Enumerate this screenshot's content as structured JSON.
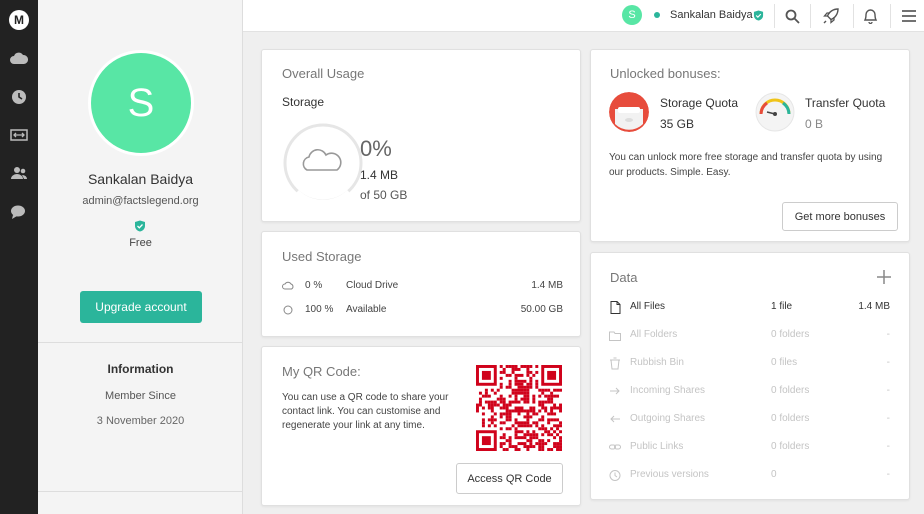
{
  "rail": {
    "logo": "M",
    "icons": [
      "cloud-icon",
      "clock-icon",
      "transfer-icon",
      "contacts-icon",
      "chat-icon"
    ]
  },
  "profile": {
    "avatar_letter": "S",
    "name": "Sankalan Baidya",
    "email": "admin@factslegend.org",
    "plan": "Free",
    "upgrade_label": "Upgrade account",
    "info_heading": "Information",
    "member_since_label": "Member Since",
    "member_since_date": "3 November 2020"
  },
  "topbar": {
    "avatar_letter": "S",
    "user_name": "Sankalan Baidya",
    "status_color": "#2bb59b",
    "icons": [
      "search-icon",
      "rocket-icon",
      "bell-icon",
      "menu-icon"
    ]
  },
  "overall_usage": {
    "title": "Overall Usage",
    "subtitle": "Storage",
    "percent": "0%",
    "used": "1.4 MB",
    "total": "of 50 GB",
    "fill_fraction": 0
  },
  "used_storage": {
    "title": "Used Storage",
    "rows": [
      {
        "icon": "cloud-icon",
        "percent": "0 %",
        "label": "Cloud Drive",
        "value": "1.4 MB"
      },
      {
        "icon": "circle-icon",
        "percent": "100 %",
        "label": "Available",
        "value": "50.00 GB"
      }
    ]
  },
  "qr": {
    "title": "My QR Code:",
    "text": "You can use a QR code to share your contact link. You can customise and regenerate your link at any time.",
    "button": "Access QR Code",
    "color": "#d0021b"
  },
  "bonuses": {
    "title": "Unlocked bonuses:",
    "storage_label": "Storage Quota",
    "storage_value": "35 GB",
    "transfer_label": "Transfer Quota",
    "transfer_value": "0 B",
    "description": "You can unlock more free storage and transfer quota by using our products. Simple. Easy.",
    "button": "Get more bonuses"
  },
  "data": {
    "title": "Data",
    "rows": [
      {
        "icon": "file-icon",
        "label": "All Files",
        "count": "1 file",
        "size": "1.4 MB",
        "active": true
      },
      {
        "icon": "folder-icon",
        "label": "All Folders",
        "count": "0 folders",
        "size": "-",
        "active": false
      },
      {
        "icon": "trash-icon",
        "label": "Rubbish Bin",
        "count": "0 files",
        "size": "-",
        "active": false
      },
      {
        "icon": "incoming-icon",
        "label": "Incoming Shares",
        "count": "0 folders",
        "size": "-",
        "active": false
      },
      {
        "icon": "outgoing-icon",
        "label": "Outgoing Shares",
        "count": "0 folders",
        "size": "-",
        "active": false
      },
      {
        "icon": "link-icon",
        "label": "Public Links",
        "count": "0 folders",
        "size": "-",
        "active": false
      },
      {
        "icon": "history-icon",
        "label": "Previous versions",
        "count": "0",
        "size": "-",
        "active": false
      }
    ]
  }
}
